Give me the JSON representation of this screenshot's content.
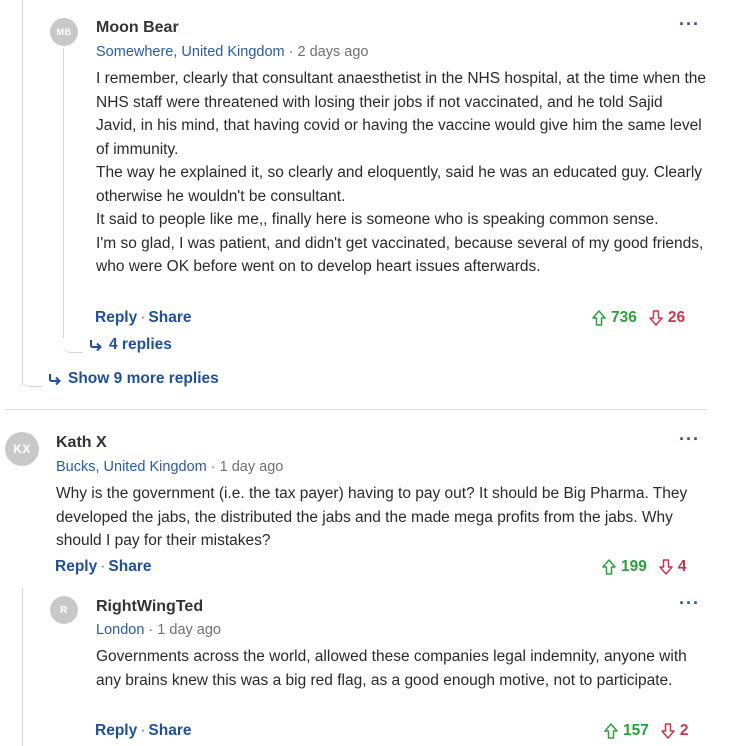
{
  "comments": [
    {
      "initials": "MB",
      "author": "Moon Bear",
      "location": "Somewhere, United Kingdom",
      "time": "2 days ago",
      "paragraphs": [
        "I remember, clearly that consultant anaesthetist in the NHS hospital, at the time when the NHS staff were threatened with losing their jobs if not vaccinated, and he  told Sajid Javid, in his mind, that having covid or having the vaccine would give him the same level of immunity.",
        "The way he explained it, so clearly and eloquently, said he was an educated guy. Clearly otherwise he wouldn't be consultant.",
        "It said to people like me,, finally here is someone who is speaking common sense.",
        "I'm so glad, I was patient, and didn't get vaccinated, because several of my good friends, who were OK before went on to develop heart issues afterwards."
      ],
      "reply_label": "Reply",
      "share_label": "Share",
      "upvotes": "736",
      "downvotes": "26",
      "replies_label": "4 replies"
    },
    {
      "initials": "KX",
      "author": "Kath X",
      "location": "Bucks, United Kingdom",
      "time": "1 day ago",
      "paragraphs": [
        "Why is the government (i.e. the tax payer) having to pay out? It should be Big Pharma. They developed the jabs, the distributed the jabs and the made mega profits from the jabs. Why should I pay for their mistakes?"
      ],
      "reply_label": "Reply",
      "share_label": "Share",
      "upvotes": "199",
      "downvotes": "4"
    },
    {
      "initials": "R",
      "author": "RightWingTed",
      "location": "London",
      "time": "1 day ago",
      "paragraphs": [
        "Governments across the world, allowed these companies legal indemnity, anyone with any brains knew this was a big red flag, as a good enough motive, not to participate."
      ],
      "reply_label": "Reply",
      "share_label": "Share",
      "upvotes": "157",
      "downvotes": "2"
    }
  ],
  "show_more_replies_label": "Show 9 more replies",
  "separator": "·",
  "icons": {
    "more": "more-options-icon",
    "up": "thumb-up-arrow-icon",
    "down": "thumb-down-arrow-icon",
    "reply_arrow": "reply-arrow-icon"
  },
  "colors": {
    "link": "#1f4f99",
    "location": "#2a5aa5",
    "upvote": "#2e9e3e",
    "downvote": "#c8364c",
    "avatar": "#c8c8c8"
  }
}
